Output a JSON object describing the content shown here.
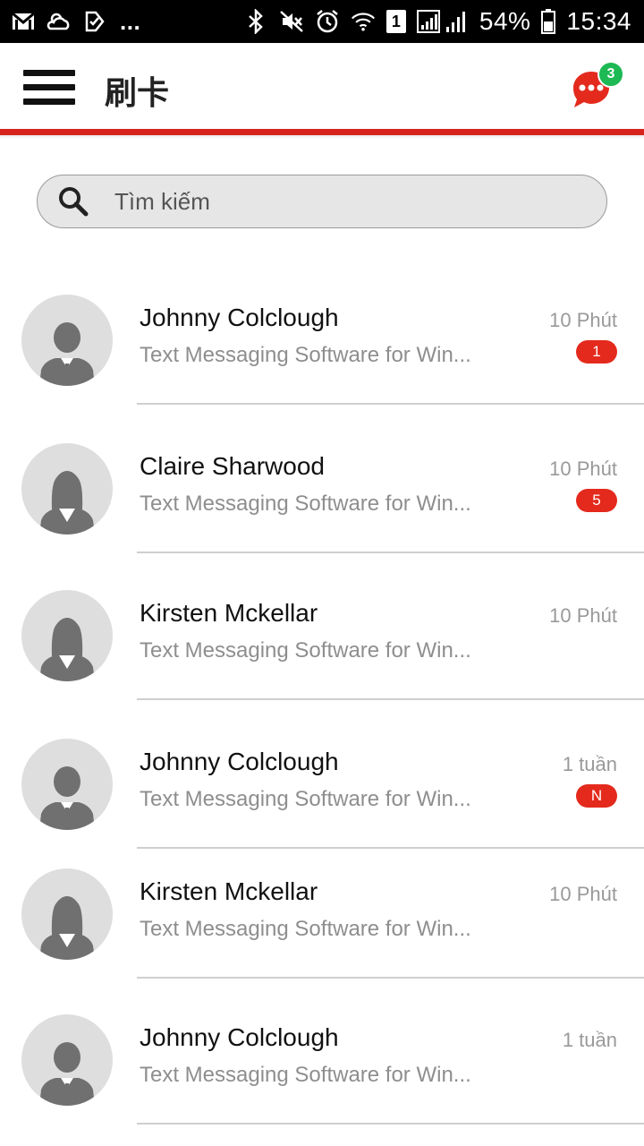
{
  "status_bar": {
    "dots": "...",
    "battery_percent": "54%",
    "time": "15:34",
    "sim_slot": "1",
    "icons": [
      "gmail-icon",
      "weather-icon",
      "check-app-icon",
      "bluetooth-icon",
      "mute-icon",
      "alarm-icon",
      "wifi-icon",
      "sim-icon",
      "signal-icon",
      "battery-icon"
    ]
  },
  "header": {
    "title": "刷卡",
    "chat_badge_count": "3",
    "accent_color": "#d6231d"
  },
  "search": {
    "placeholder": "Tìm kiếm"
  },
  "conversations": [
    {
      "name": "Johnny Colclough",
      "preview": "Text Messaging Software for Win...",
      "time": "10 Phút",
      "badge": "1",
      "avatar": "male"
    },
    {
      "name": "Claire Sharwood",
      "preview": "Text Messaging Software for Win...",
      "time": "10 Phút",
      "badge": "5",
      "avatar": "female"
    },
    {
      "name": "Kirsten Mckellar",
      "preview": "Text Messaging Software for Win...",
      "time": "10 Phút",
      "badge": "",
      "avatar": "female"
    },
    {
      "name": "Johnny Colclough",
      "preview": "Text Messaging Software for Win...",
      "time": "1 tuần",
      "badge": "N",
      "avatar": "male"
    },
    {
      "name": "Kirsten Mckellar",
      "preview": "Text Messaging Software for Win...",
      "time": "10 Phút",
      "badge": "",
      "avatar": "female"
    },
    {
      "name": "Johnny Colclough",
      "preview": "Text Messaging Software for Win...",
      "time": "1 tuần",
      "badge": "",
      "avatar": "male"
    }
  ]
}
